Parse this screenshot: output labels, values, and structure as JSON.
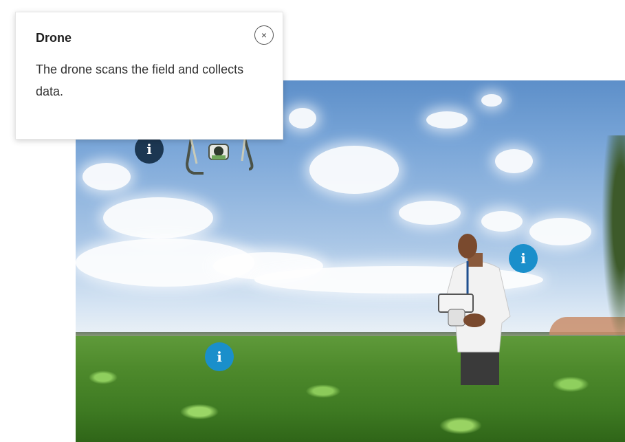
{
  "popover": {
    "title": "Drone",
    "body": "The drone scans the field and collects data.",
    "close_glyph": "×"
  },
  "hotspots": [
    {
      "name": "hotspot-drone",
      "glyph": "i",
      "color": "#1c3752"
    },
    {
      "name": "hotspot-person",
      "glyph": "i",
      "color": "#1a8fcb"
    },
    {
      "name": "hotspot-field",
      "glyph": "i",
      "color": "#1a8fcb"
    }
  ],
  "colors": {
    "hotspot_blue": "#1a8fcb",
    "hotspot_dark": "#1c3752"
  }
}
